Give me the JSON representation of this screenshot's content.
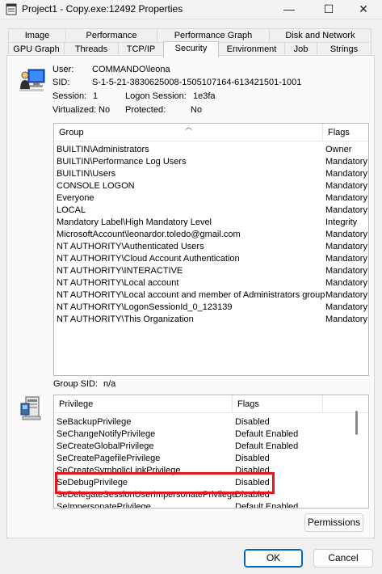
{
  "window": {
    "title": "Project1 - Copy.exe:12492 Properties",
    "minimize": "—",
    "maximize": "☐",
    "close": "✕"
  },
  "tabs_top": [
    "Image",
    "Performance",
    "Performance Graph",
    "Disk and Network"
  ],
  "tabs_bottom": [
    "GPU Graph",
    "Threads",
    "TCP/IP",
    "Security",
    "Environment",
    "Job",
    "Strings"
  ],
  "active_tab": "Security",
  "security": {
    "user_label": "User:",
    "user_value": "COMMANDO\\leona",
    "sid_label": "SID:",
    "sid_value": "S-1-5-21-3830625008-1505107164-613421501-1001",
    "session_label": "Session:",
    "session_value": "1",
    "logon_session_label": "Logon Session:",
    "logon_session_value": "1e3fa",
    "virtualized_label": "Virtualized:",
    "virtualized_value": "No",
    "protected_label": "Protected:",
    "protected_value": "No",
    "group_sid_label": "Group SID:",
    "group_sid_value": "n/a"
  },
  "groups": {
    "headers": [
      "Group",
      "Flags"
    ],
    "rows": [
      [
        "BUILTIN\\Administrators",
        "Owner"
      ],
      [
        "BUILTIN\\Performance Log Users",
        "Mandatory"
      ],
      [
        "BUILTIN\\Users",
        "Mandatory"
      ],
      [
        "CONSOLE LOGON",
        "Mandatory"
      ],
      [
        "Everyone",
        "Mandatory"
      ],
      [
        "LOCAL",
        "Mandatory"
      ],
      [
        "Mandatory Label\\High Mandatory Level",
        "Integrity"
      ],
      [
        "MicrosoftAccount\\leonardor.toledo@gmail.com",
        "Mandatory"
      ],
      [
        "NT AUTHORITY\\Authenticated Users",
        "Mandatory"
      ],
      [
        "NT AUTHORITY\\Cloud Account Authentication",
        "Mandatory"
      ],
      [
        "NT AUTHORITY\\INTERACTIVE",
        "Mandatory"
      ],
      [
        "NT AUTHORITY\\Local account",
        "Mandatory"
      ],
      [
        "NT AUTHORITY\\Local account and member of Administrators group",
        "Mandatory"
      ],
      [
        "NT AUTHORITY\\LogonSessionId_0_123139",
        "Mandatory"
      ],
      [
        "NT AUTHORITY\\This Organization",
        "Mandatory"
      ]
    ]
  },
  "privileges": {
    "headers": [
      "Privilege",
      "Flags"
    ],
    "rows": [
      [
        "SeBackupPrivilege",
        "Disabled"
      ],
      [
        "SeChangeNotifyPrivilege",
        "Default Enabled"
      ],
      [
        "SeCreateGlobalPrivilege",
        "Default Enabled"
      ],
      [
        "SeCreatePagefilePrivilege",
        "Disabled"
      ],
      [
        "SeCreateSymbolicLinkPrivilege",
        "Disabled"
      ],
      [
        "SeDebugPrivilege",
        "Disabled"
      ],
      [
        "SeDelegateSessionUserImpersonatePrivilege",
        "Disabled"
      ],
      [
        "SeImpersonatePrivilege",
        "Default Enabled"
      ]
    ]
  },
  "buttons": {
    "permissions": "Permissions",
    "ok": "OK",
    "cancel": "Cancel"
  },
  "colors": {
    "highlight_border": "#e8151b",
    "ok_border": "#0067c0"
  }
}
